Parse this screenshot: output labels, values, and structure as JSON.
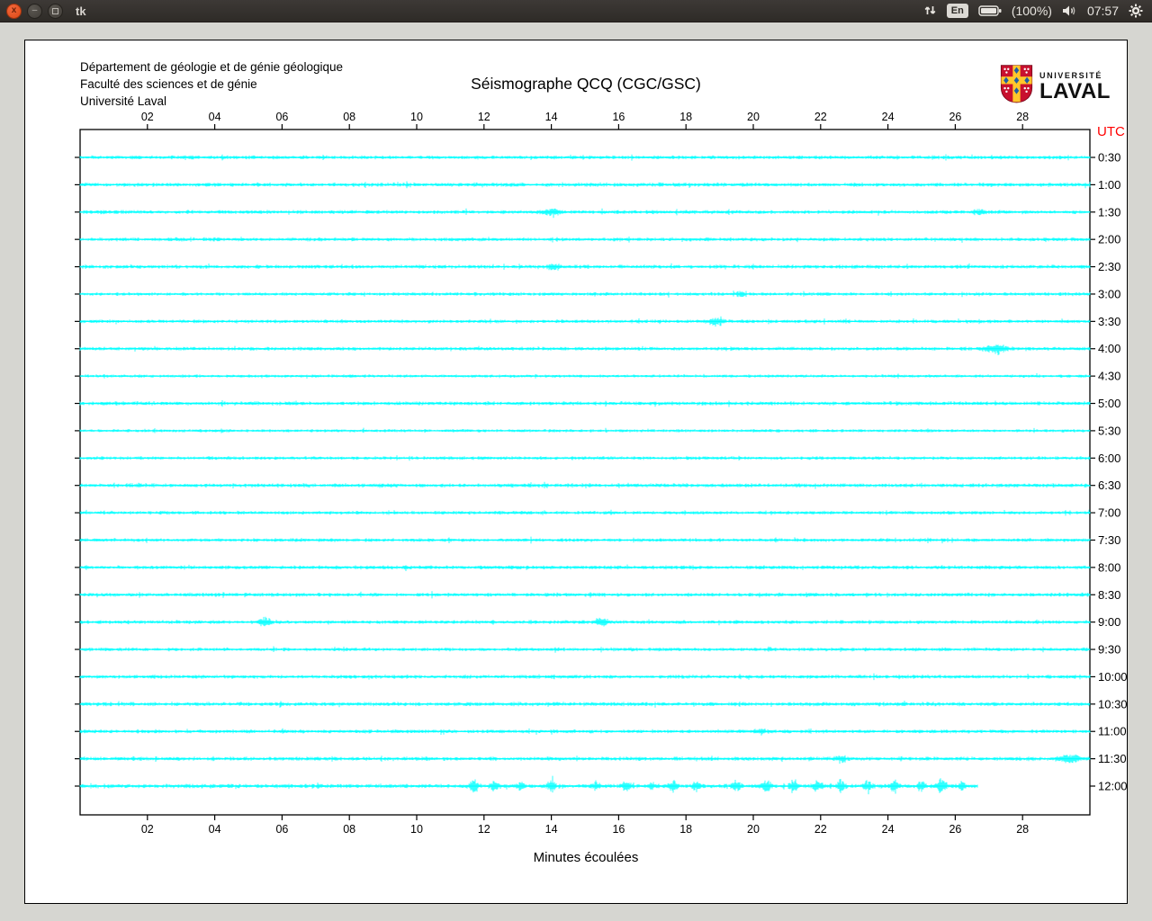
{
  "topbar": {
    "window_title": "tk",
    "close_glyph": "x",
    "minimize_glyph": "–",
    "keyboard_layout": "En",
    "battery_percent": "(100%)",
    "clock": "07:57",
    "icons": [
      "close-icon",
      "minimize-icon",
      "maximize-icon",
      "updown-arrows-icon",
      "keyboard-layout-badge",
      "battery-icon",
      "volume-icon",
      "gear-icon"
    ]
  },
  "app": {
    "header_lines": [
      "Département de géologie et de génie géologique",
      "Faculté des sciences et de génie",
      "Université Laval"
    ],
    "title": "Séismographe QCQ (CGC/GSC)",
    "logo": {
      "line1": "UNIVERSITÉ",
      "line2": "LAVAL"
    }
  },
  "chart_data": {
    "type": "line",
    "title": "Séismographe QCQ (CGC/GSC)",
    "xlabel": "Minutes écoulées",
    "x_range": [
      0,
      30
    ],
    "x_ticks": [
      "02",
      "04",
      "06",
      "08",
      "10",
      "12",
      "14",
      "16",
      "18",
      "20",
      "22",
      "24",
      "26",
      "28"
    ],
    "right_axis_label": "UTC",
    "right_axis_label_color": "#ff0000",
    "trace_color": "#00ffff",
    "axis_color": "#000000",
    "grid": false,
    "rows": [
      {
        "label": "0:30",
        "base": 2.4,
        "end": 1.0,
        "events": []
      },
      {
        "label": "1:00",
        "base": 2.6,
        "end": 1.0,
        "events": []
      },
      {
        "label": "1:30",
        "base": 2.4,
        "end": 1.0,
        "events": [
          {
            "m": 14.0,
            "w": 0.25,
            "amp": 4
          },
          {
            "m": 26.7,
            "w": 0.2,
            "amp": 3
          }
        ]
      },
      {
        "label": "2:00",
        "base": 2.4,
        "end": 1.0,
        "events": []
      },
      {
        "label": "2:30",
        "base": 2.5,
        "end": 1.0,
        "events": [
          {
            "m": 14.1,
            "w": 0.2,
            "amp": 4
          }
        ]
      },
      {
        "label": "3:00",
        "base": 2.3,
        "end": 1.0,
        "events": [
          {
            "m": 19.6,
            "w": 0.15,
            "amp": 2.5
          }
        ]
      },
      {
        "label": "3:30",
        "base": 2.3,
        "end": 1.0,
        "events": [
          {
            "m": 18.9,
            "w": 0.2,
            "amp": 5
          }
        ]
      },
      {
        "label": "4:00",
        "base": 2.3,
        "end": 1.0,
        "events": [
          {
            "m": 27.2,
            "w": 0.3,
            "amp": 6
          }
        ]
      },
      {
        "label": "4:30",
        "base": 2.0,
        "end": 1.0,
        "events": []
      },
      {
        "label": "5:00",
        "base": 2.5,
        "end": 1.0,
        "events": []
      },
      {
        "label": "5:30",
        "base": 2.0,
        "end": 1.0,
        "events": []
      },
      {
        "label": "6:00",
        "base": 2.2,
        "end": 1.0,
        "events": []
      },
      {
        "label": "6:30",
        "base": 2.6,
        "end": 1.0,
        "events": []
      },
      {
        "label": "7:00",
        "base": 2.3,
        "end": 1.0,
        "events": []
      },
      {
        "label": "7:30",
        "base": 2.3,
        "end": 1.0,
        "events": []
      },
      {
        "label": "8:00",
        "base": 2.5,
        "end": 1.0,
        "events": []
      },
      {
        "label": "8:30",
        "base": 2.5,
        "end": 1.0,
        "events": []
      },
      {
        "label": "9:00",
        "base": 2.4,
        "end": 1.0,
        "events": [
          {
            "m": 5.5,
            "w": 0.15,
            "amp": 7
          },
          {
            "m": 15.5,
            "w": 0.2,
            "amp": 4
          }
        ]
      },
      {
        "label": "9:30",
        "base": 2.3,
        "end": 1.0,
        "events": []
      },
      {
        "label": "10:00",
        "base": 2.5,
        "end": 1.0,
        "events": []
      },
      {
        "label": "10:30",
        "base": 2.6,
        "end": 1.0,
        "events": []
      },
      {
        "label": "11:00",
        "base": 2.4,
        "end": 1.0,
        "events": [
          {
            "m": 20.2,
            "w": 0.15,
            "amp": 3.5
          }
        ]
      },
      {
        "label": "11:30",
        "base": 2.6,
        "end": 1.0,
        "events": [
          {
            "m": 22.6,
            "w": 0.2,
            "amp": 4
          },
          {
            "m": 29.4,
            "w": 0.3,
            "amp": 5
          }
        ]
      },
      {
        "label": "12:00",
        "base": 2.8,
        "end": 0.889,
        "events": [
          {
            "m": 11.7,
            "w": 0.12,
            "amp": 8
          },
          {
            "m": 12.3,
            "w": 0.12,
            "amp": 7
          },
          {
            "m": 13.1,
            "w": 0.1,
            "amp": 5
          },
          {
            "m": 14.0,
            "w": 0.12,
            "amp": 6
          },
          {
            "m": 15.3,
            "w": 0.1,
            "amp": 5
          },
          {
            "m": 16.2,
            "w": 0.12,
            "amp": 7
          },
          {
            "m": 17.0,
            "w": 0.1,
            "amp": 5
          },
          {
            "m": 17.6,
            "w": 0.12,
            "amp": 6
          },
          {
            "m": 18.3,
            "w": 0.1,
            "amp": 5
          },
          {
            "m": 19.5,
            "w": 0.12,
            "amp": 8
          },
          {
            "m": 20.4,
            "w": 0.12,
            "amp": 7
          },
          {
            "m": 21.2,
            "w": 0.1,
            "amp": 9
          },
          {
            "m": 21.9,
            "w": 0.12,
            "amp": 7
          },
          {
            "m": 22.6,
            "w": 0.1,
            "amp": 8
          },
          {
            "m": 23.4,
            "w": 0.12,
            "amp": 6
          },
          {
            "m": 24.2,
            "w": 0.12,
            "amp": 8
          },
          {
            "m": 25.0,
            "w": 0.1,
            "amp": 7
          },
          {
            "m": 25.6,
            "w": 0.12,
            "amp": 9
          },
          {
            "m": 26.2,
            "w": 0.1,
            "amp": 7
          }
        ]
      }
    ]
  }
}
